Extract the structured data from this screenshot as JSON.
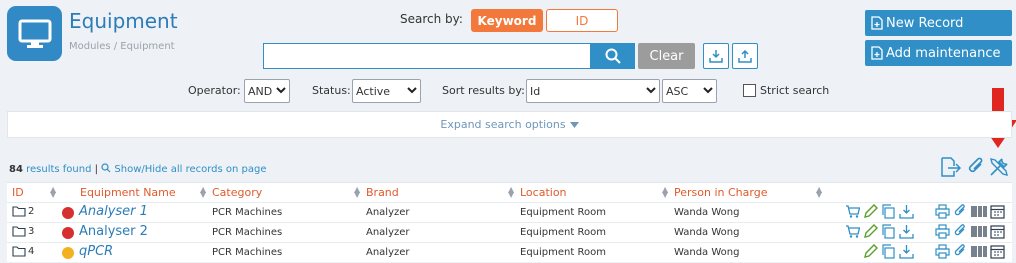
{
  "header": {
    "title": "Equipment",
    "breadcrumb": "Modules / Equipment"
  },
  "search": {
    "label": "Search by:",
    "modes": [
      "Keyword",
      "ID"
    ],
    "active_mode": "Keyword",
    "query": "",
    "clear_label": "Clear"
  },
  "actions": {
    "new_record": "New Record",
    "add_maintenance": "Add maintenance"
  },
  "filters": {
    "operator_label": "Operator:",
    "operator_value": "AND",
    "status_label": "Status:",
    "status_value": "Active",
    "sort_label": "Sort results by:",
    "sort_value": "Id",
    "order_value": "ASC",
    "strict_label": "Strict search",
    "strict_checked": false
  },
  "expand_label": "Expand search options",
  "results": {
    "count": "84",
    "found_text": "results found",
    "separator": "|",
    "toggle_label": "Show/Hide all records on page"
  },
  "table": {
    "columns": [
      "ID",
      "Equipment Name",
      "Category",
      "Brand",
      "Location",
      "Person in Charge"
    ],
    "rows": [
      {
        "id": "2",
        "status_color": "#d62f2f",
        "name": "Analyser 1",
        "italic": true,
        "category": "PCR Machines",
        "brand": "Analyzer",
        "location": "Equipment Room",
        "person": "Wanda Wong",
        "has_cart": true
      },
      {
        "id": "3",
        "status_color": "#d62f2f",
        "name": "Analyser 2",
        "italic": false,
        "category": "PCR Machines",
        "brand": "Analyzer",
        "location": "Equipment Room",
        "person": "Wanda Wong",
        "has_cart": true
      },
      {
        "id": "4",
        "status_color": "#f2b21f",
        "name": "qPCR",
        "italic": true,
        "category": "PCR Machines",
        "brand": "Analyzer",
        "location": "Equipment Room",
        "person": "Wanda Wong",
        "has_cart": false
      }
    ]
  },
  "colors": {
    "primary": "#2f8fc6",
    "accent": "#f2793b",
    "header_text": "#e05a2b",
    "arrow": "#e0271f"
  }
}
